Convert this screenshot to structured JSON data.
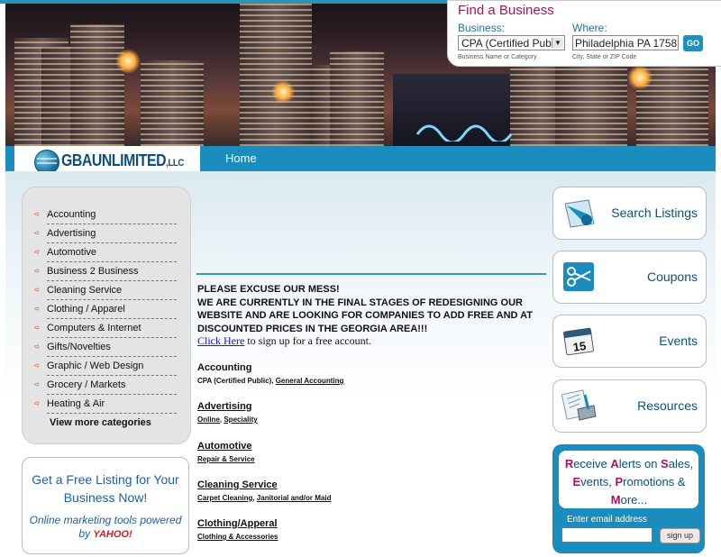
{
  "find_business": {
    "title": "Find a Business",
    "business_label": "Business:",
    "business_value": "CPA (Certified Pub",
    "where_label": "Where:",
    "where_value": "Philadelphia PA 1758",
    "go_label": "GO",
    "business_hint": "Business Name or Category",
    "where_hint": "City, State or ZIP Code"
  },
  "header": {
    "logo_text": "GBAUNLIMITED",
    "logo_suffix": ",LLC",
    "nav": [
      "Home"
    ]
  },
  "sidebar": {
    "categories": [
      "Accounting",
      "Advertising",
      "Automotive",
      "Business 2 Business",
      "Cleaning Service",
      "Clothing / Apparel",
      "Computers & Internet",
      "Gifts/Novelties",
      "Graphic / Web Design",
      "Grocery / Markets",
      "Heating & Air"
    ],
    "view_more": "View more categories",
    "free_listing": {
      "title": "Get a Free Listing for Your Business Now!",
      "subtitle": "Online marketing tools powered by",
      "brand": "YAHOO!"
    }
  },
  "main": {
    "notice": [
      "PLEASE EXCUSE OUR MESS!",
      "WE ARE CURRENTLY IN THE FINAL STAGES OF REDESIGNING OUR WEBSITE AND ARE LOOKING FOR COMPANIES TO ADD FREE AND AT DISCOUNTED PRICES IN THE GEORGIA AREA!!!"
    ],
    "click_here": "Click Here",
    "click_rest": "to sign up for a free account.",
    "category_listings": [
      {
        "heading": "Accounting",
        "subs": [
          "CPA (Certified Public)",
          "General Accounting"
        ]
      },
      {
        "heading": "Advertising",
        "subs": [
          "Online",
          "Speciality"
        ]
      },
      {
        "heading": "Automotive",
        "subs": [
          "Repair & Service"
        ]
      },
      {
        "heading": "Cleaning Service",
        "subs": [
          "Carpet Cleaning",
          "Janitorial and/or Maid"
        ]
      },
      {
        "heading": "Clothing/Apperal",
        "subs": [
          "Clothing & Accessories"
        ]
      }
    ]
  },
  "right_panel": {
    "features": [
      {
        "label": "Search Listings",
        "icon": "search-listings-icon"
      },
      {
        "label": "Coupons",
        "icon": "scissors-icon"
      },
      {
        "label": "Events",
        "icon": "calendar-icon"
      },
      {
        "label": "Resources",
        "icon": "clipboard-icon"
      }
    ],
    "calendar_day": "15",
    "alerts": {
      "text_parts": [
        "R",
        "eceive ",
        "A",
        "lerts on ",
        "S",
        "ales, ",
        "E",
        "vents, ",
        "P",
        "romotions & ",
        "M",
        "ore..."
      ],
      "email_label": "Enter email address",
      "signup_label": "sign up"
    }
  },
  "colors": {
    "brand_blue": "#1a8cbd",
    "accent_magenta": "#b0105a",
    "logo_navy": "#0d4f7a"
  }
}
